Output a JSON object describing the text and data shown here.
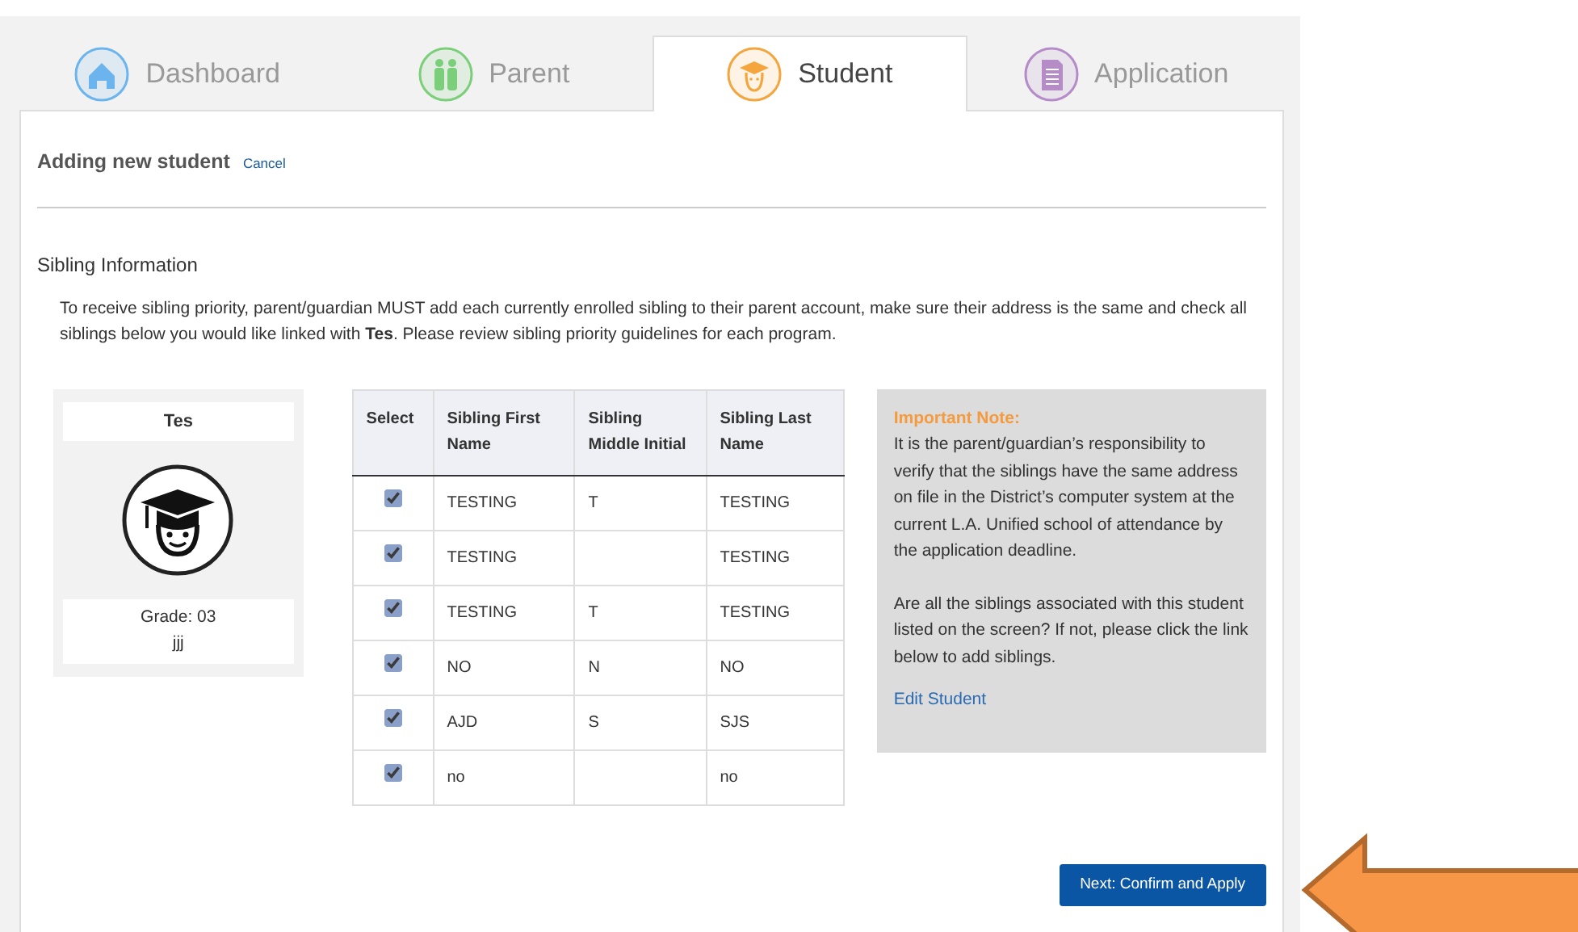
{
  "tabs": [
    {
      "label": "Dashboard",
      "kind": "house",
      "color": "#6cb4ee",
      "selected": false
    },
    {
      "label": "Parent",
      "kind": "people",
      "color": "#7bcf7b",
      "selected": false
    },
    {
      "label": "Student",
      "kind": "student",
      "color": "#f5a53d",
      "selected": true
    },
    {
      "label": "Application",
      "kind": "document",
      "color": "#b58cc8",
      "selected": false
    }
  ],
  "header": {
    "title": "Adding new student",
    "cancel": "Cancel"
  },
  "section_title": "Sibling Information",
  "instructions": "To receive sibling priority, parent/guardian MUST add each currently enrolled sibling to their parent account, make sure their address is the same and check all siblings below you would like linked with **Tes**. Please review sibling priority guidelines for each program.",
  "student_card": {
    "name": "Tes",
    "grade": "Grade: 03",
    "link": "jjj"
  },
  "table": {
    "columns": [
      "Select",
      "Sibling First Name",
      "Sibling Middle Initial",
      "Sibling Last Name"
    ],
    "rows": [
      {
        "checked": true,
        "first": "TESTING",
        "middle": "T",
        "last": "TESTING"
      },
      {
        "checked": true,
        "first": "TESTING",
        "middle": "",
        "last": "TESTING"
      },
      {
        "checked": true,
        "first": "TESTING",
        "middle": "T",
        "last": "TESTING"
      },
      {
        "checked": true,
        "first": "NO",
        "middle": "N",
        "last": "NO"
      },
      {
        "checked": true,
        "first": "AJD",
        "middle": "S",
        "last": "SJS"
      },
      {
        "checked": true,
        "first": "no",
        "middle": "",
        "last": "no"
      }
    ]
  },
  "note": {
    "title": "Important Note:",
    "paragraphs": [
      "It is the parent/guardian’s responsibility to verify that the siblings have the same address on file in the District’s computer system at the current L.A. Unified school of attendance by the application deadline.",
      "Are all the siblings associated with this student listed on the screen? If not, please click the link below to add siblings."
    ],
    "link": "Edit Student"
  },
  "next_button": "Next: Confirm and Apply"
}
